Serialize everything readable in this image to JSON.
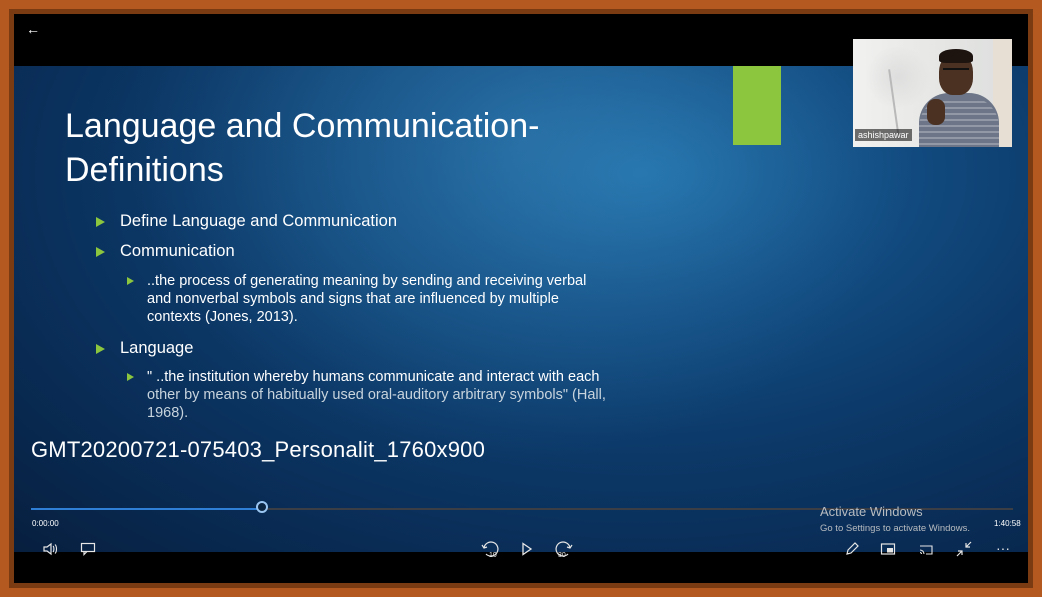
{
  "video": {
    "title": "GMT20200721-075403_Personalit_1760x900",
    "elapsed": "0:00:00",
    "total": "1:40:58",
    "progress": 0.235
  },
  "slide": {
    "title_line1": "Language and Communication-",
    "title_line2": "Definitions",
    "bullets": [
      "Define Language and Communication",
      "Communication",
      "..the process of generating meaning by sending and receiving verbal",
      "and nonverbal symbols and signs that are influenced by multiple",
      "contexts (Jones, 2013).",
      "Language",
      "\" ..the institution whereby humans communicate and interact with each",
      "other by means of habitually used oral-auditory arbitrary symbols\" (Hall,",
      "1968)."
    ],
    "accent_color": "#8cc63f"
  },
  "webcam": {
    "name": "ashishpawar"
  },
  "watermark": {
    "line1": "Activate Windows",
    "line2": "Go to Settings to activate Windows."
  },
  "controls": {
    "back": "←",
    "skip_back_seconds": "10",
    "skip_forward_seconds": "30",
    "more": "···"
  },
  "icons": [
    "back-arrow-icon",
    "volume-icon",
    "captions-icon",
    "rewind-10-icon",
    "play-icon",
    "forward-30-icon",
    "pen-icon",
    "miniview-icon",
    "casting-icon",
    "exit-fullscreen-icon",
    "more-icon"
  ]
}
